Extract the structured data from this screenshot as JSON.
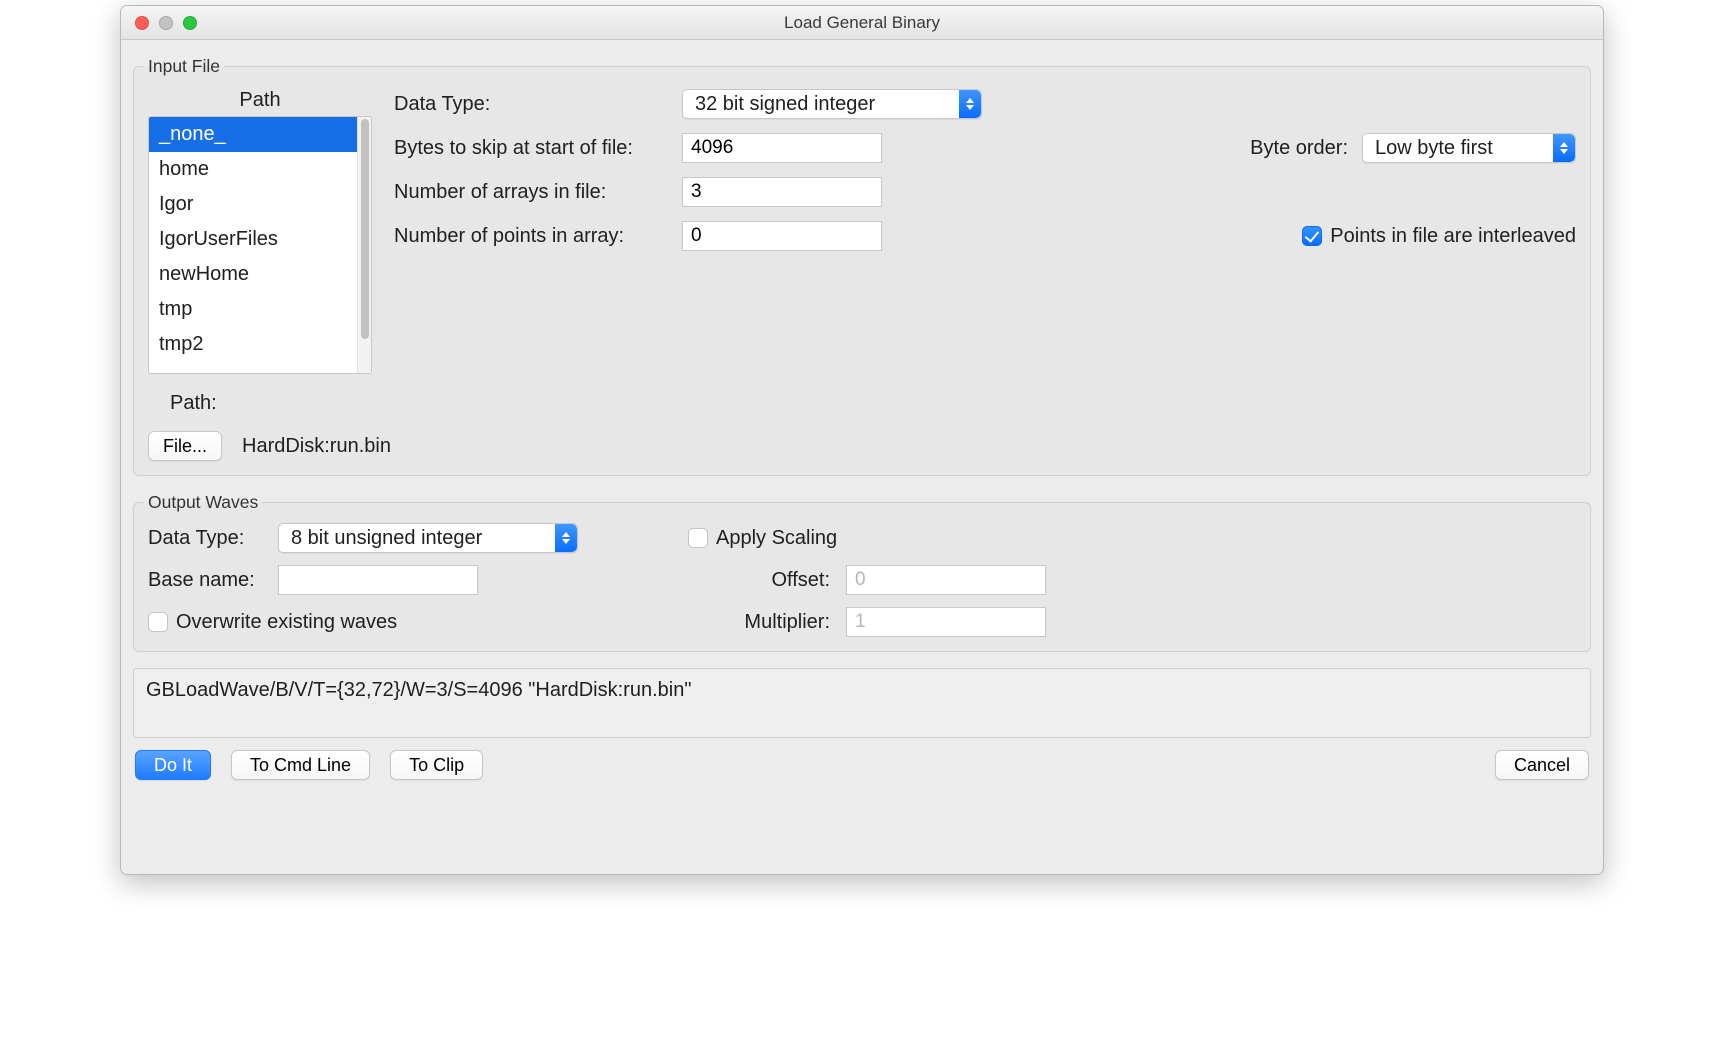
{
  "window": {
    "title": "Load General Binary"
  },
  "input_file": {
    "legend": "Input File",
    "path_header": "Path",
    "path_items": [
      "_none_",
      "home",
      "Igor",
      "IgorUserFiles",
      "newHome",
      "tmp",
      "tmp2"
    ],
    "path_selected_index": 0,
    "path_label": "Path:",
    "file_button": "File...",
    "file_path": "HardDisk:run.bin",
    "data_type_label": "Data Type:",
    "data_type_value": "32 bit signed integer",
    "bytes_skip_label": "Bytes to skip at start of file:",
    "bytes_skip_value": "4096",
    "num_arrays_label": "Number of arrays in file:",
    "num_arrays_value": "3",
    "num_points_label": "Number of points in array:",
    "num_points_value": "0",
    "byte_order_label": "Byte order:",
    "byte_order_value": "Low byte first",
    "interleaved_label": "Points in file are interleaved",
    "interleaved_checked": true
  },
  "output_waves": {
    "legend": "Output Waves",
    "data_type_label": "Data Type:",
    "data_type_value": "8 bit unsigned integer",
    "base_name_label": "Base name:",
    "base_name_value": "",
    "overwrite_label": "Overwrite existing waves",
    "overwrite_checked": false,
    "apply_scaling_label": "Apply Scaling",
    "apply_scaling_checked": false,
    "offset_label": "Offset:",
    "offset_value": "0",
    "multiplier_label": "Multiplier:",
    "multiplier_value": "1"
  },
  "command": "GBLoadWave/B/V/T={32,72}/W=3/S=4096 \"HardDisk:run.bin\"",
  "buttons": {
    "do_it": "Do It",
    "to_cmd_line": "To Cmd Line",
    "to_clip": "To Clip",
    "cancel": "Cancel"
  }
}
